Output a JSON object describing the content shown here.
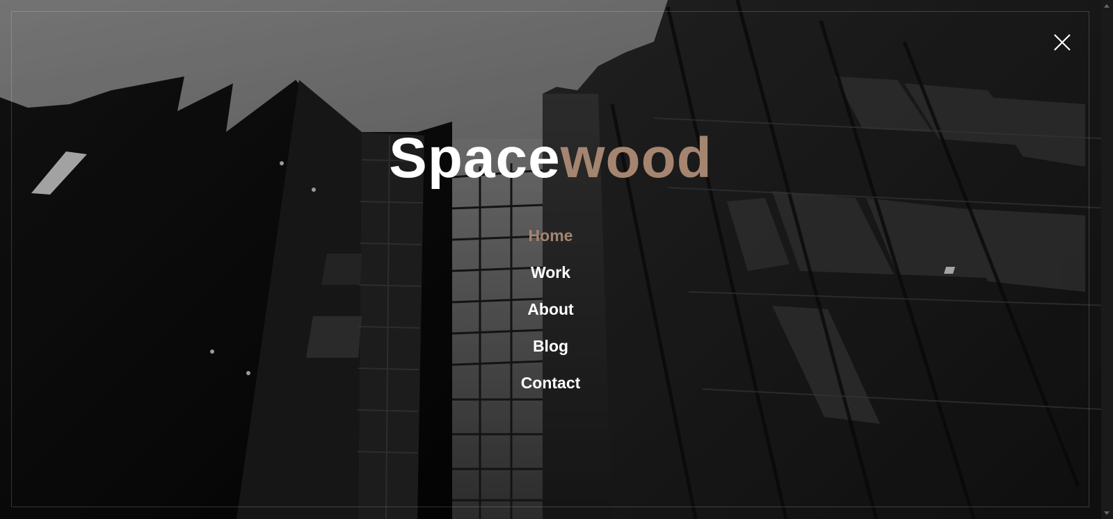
{
  "brand": {
    "part_a": "Space",
    "part_b": "wood",
    "accent_color": "#a58570"
  },
  "menu": {
    "items": [
      {
        "label": "Home",
        "active": true
      },
      {
        "label": "Work",
        "active": false
      },
      {
        "label": "About",
        "active": false
      },
      {
        "label": "Blog",
        "active": false
      },
      {
        "label": "Contact",
        "active": false
      }
    ]
  },
  "controls": {
    "close_icon": "close-icon"
  },
  "background": {
    "subject": "grayscale-building-facade-image"
  }
}
